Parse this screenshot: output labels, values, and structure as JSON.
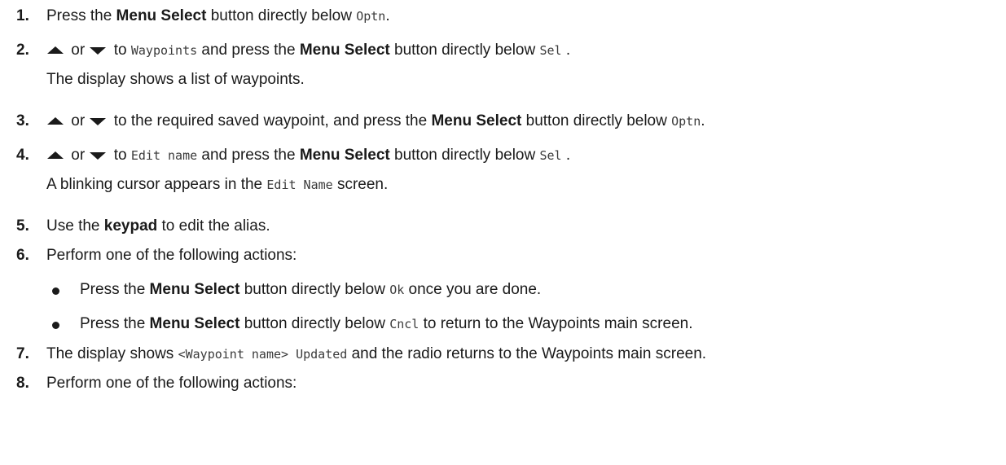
{
  "steps": [
    {
      "num": "1.",
      "before": "Press the ",
      "bold": "Menu Select",
      "middle": " button directly below ",
      "mono": "Optn",
      "after": "."
    },
    {
      "num": "2.",
      "or": " or ",
      "to": " to ",
      "mono1": "Waypoints",
      "mid": " and press the ",
      "bold": "Menu Select",
      "mid2": " button directly below ",
      "mono2": "Sel",
      "after": " .",
      "result": "The display shows a list of waypoints."
    },
    {
      "num": "3.",
      "or": " or ",
      "to": " to the required saved waypoint, and press the ",
      "bold": "Menu Select",
      "mid2": " button directly below ",
      "mono": "Optn",
      "after": "."
    },
    {
      "num": "4.",
      "or": " or ",
      "to": " to ",
      "mono1": "Edit name",
      "mid": " and press the ",
      "bold": "Menu Select",
      "mid2": " button directly below ",
      "mono2": "Sel",
      "after": " .",
      "result_before": "A blinking cursor appears in the ",
      "result_mono": "Edit Name",
      "result_after": " screen."
    },
    {
      "num": "5.",
      "before": "Use the ",
      "bold": "keypad",
      "after": " to edit the alias."
    },
    {
      "num": "6.",
      "text": "Perform one of the following actions:",
      "bullets": [
        {
          "before": "Press the ",
          "bold": "Menu Select",
          "mid": " button directly below ",
          "mono": "Ok",
          "after": " once you are done."
        },
        {
          "before": "Press the ",
          "bold": "Menu Select",
          "mid": " button directly below ",
          "mono": "Cncl",
          "after": " to return to the Waypoints main screen."
        }
      ]
    },
    {
      "num": "7.",
      "before": "The display shows ",
      "mono": "<Waypoint name> Updated",
      "after": " and the radio returns to the Waypoints main screen."
    },
    {
      "num": "8.",
      "text": "Perform one of the following actions:"
    }
  ],
  "icons": {
    "up": "arrow-up-icon",
    "down": "arrow-down-icon"
  }
}
